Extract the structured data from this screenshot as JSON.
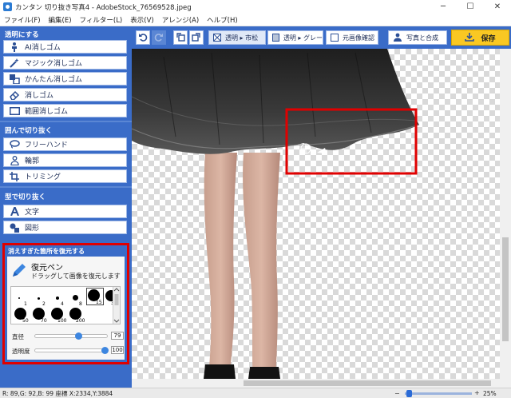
{
  "window": {
    "title": "カンタン 切り抜き写真4 - AdobeStock_76569528.jpeg",
    "min": "─",
    "max": "☐",
    "close": "✕"
  },
  "menu": [
    "ファイル(F)",
    "編集(E)",
    "フィルター(L)",
    "表示(V)",
    "アレンジ(A)",
    "ヘルプ(H)"
  ],
  "sidebar": {
    "transparent_title": "透明にする",
    "transparent_tools": [
      "AI消しゴム",
      "マジック消しゴム",
      "かんたん消しゴム",
      "消しゴム",
      "範囲消しゴム"
    ],
    "cut_enclose_title": "囲んで切り抜く",
    "cut_enclose_tools": [
      "フリーハンド",
      "輪郭",
      "トリミング"
    ],
    "cut_shape_title": "型で切り抜く",
    "cut_shape_tools": [
      "文字",
      "図形"
    ],
    "restore": {
      "title": "消えすぎた箇所を復元する",
      "pen_title": "復元ペン",
      "pen_desc": "ドラッグして画像を復元します",
      "brush_sizes": [
        "1",
        "2",
        "4",
        "8",
        "15",
        "30",
        "50",
        "70",
        "100",
        "200"
      ],
      "selected_brush": "30",
      "diameter_label": "直径",
      "diameter_value": "79",
      "opacity_label": "透明度",
      "opacity_value": "100",
      "diameter_fraction": 0.6,
      "opacity_fraction": 1.0
    }
  },
  "toolbar": {
    "bg_checker_label": "透明 ▸ 市松",
    "bg_gray_label": "透明 ▸ グレー",
    "original_label": "元画像確認",
    "compose_label": "写真と合成",
    "save_label": "保存"
  },
  "status": {
    "text": "R: 89,G: 92,B: 99  座標 X:2334,Y:3884",
    "zoom_percent": "25%"
  },
  "colors": {
    "sidebar_blue": "#3a6cc8",
    "highlight_red": "#e00000",
    "save_yellow": "#f9c823"
  }
}
